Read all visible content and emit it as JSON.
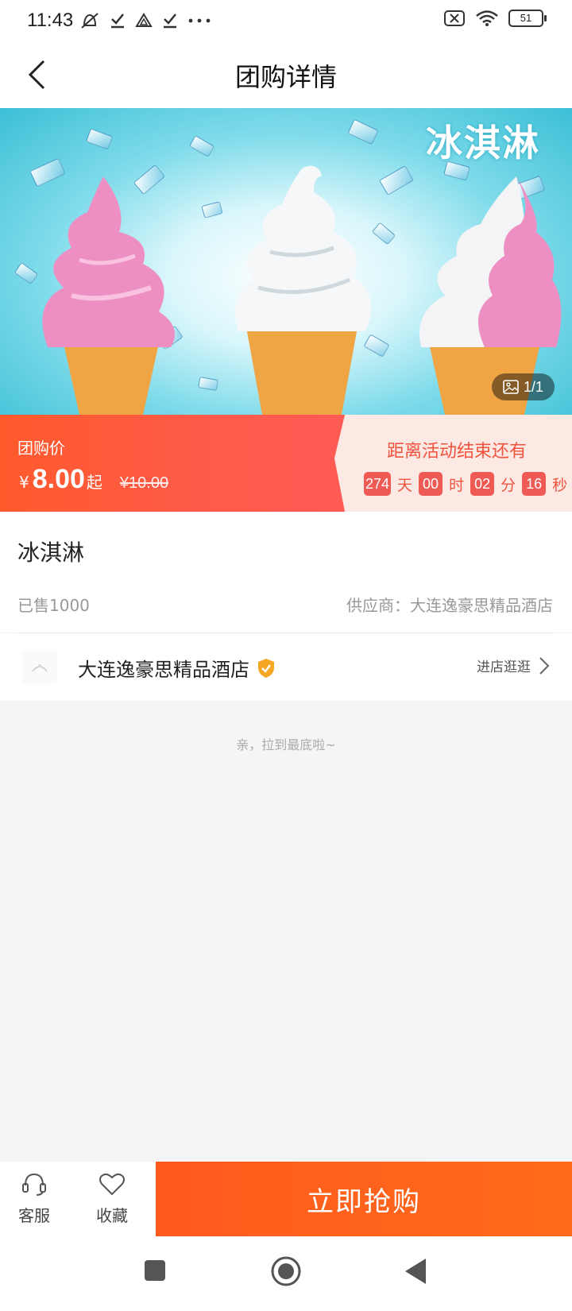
{
  "status_bar": {
    "time": "11:43",
    "battery": "51"
  },
  "nav": {
    "title": "团购详情"
  },
  "hero": {
    "image_title": "冰淇淋",
    "pager": "1/1"
  },
  "price": {
    "label": "团购价",
    "currency": "¥",
    "value": "8.00",
    "suffix": "起",
    "original": "¥10.00",
    "countdown_title": "距离活动结束还有",
    "days": "274",
    "days_unit": "天",
    "hours": "00",
    "hours_unit": "时",
    "minutes": "02",
    "minutes_unit": "分",
    "seconds": "16",
    "seconds_unit": "秒"
  },
  "product": {
    "name": "冰淇淋",
    "sold": "已售1000",
    "supplier": "供应商：大连逸豪思精品酒店"
  },
  "store": {
    "name": "大连逸豪思精品酒店",
    "visit_label": "进店逛逛"
  },
  "bottom_tip": "亲，拉到最底啦~",
  "actions": {
    "service_label": "客服",
    "favorite_label": "收藏",
    "buy_label": "立即抢购"
  },
  "colors": {
    "accent": "#ff5a2c",
    "countdown": "#f05a55",
    "buy": "#ff6a1a"
  }
}
